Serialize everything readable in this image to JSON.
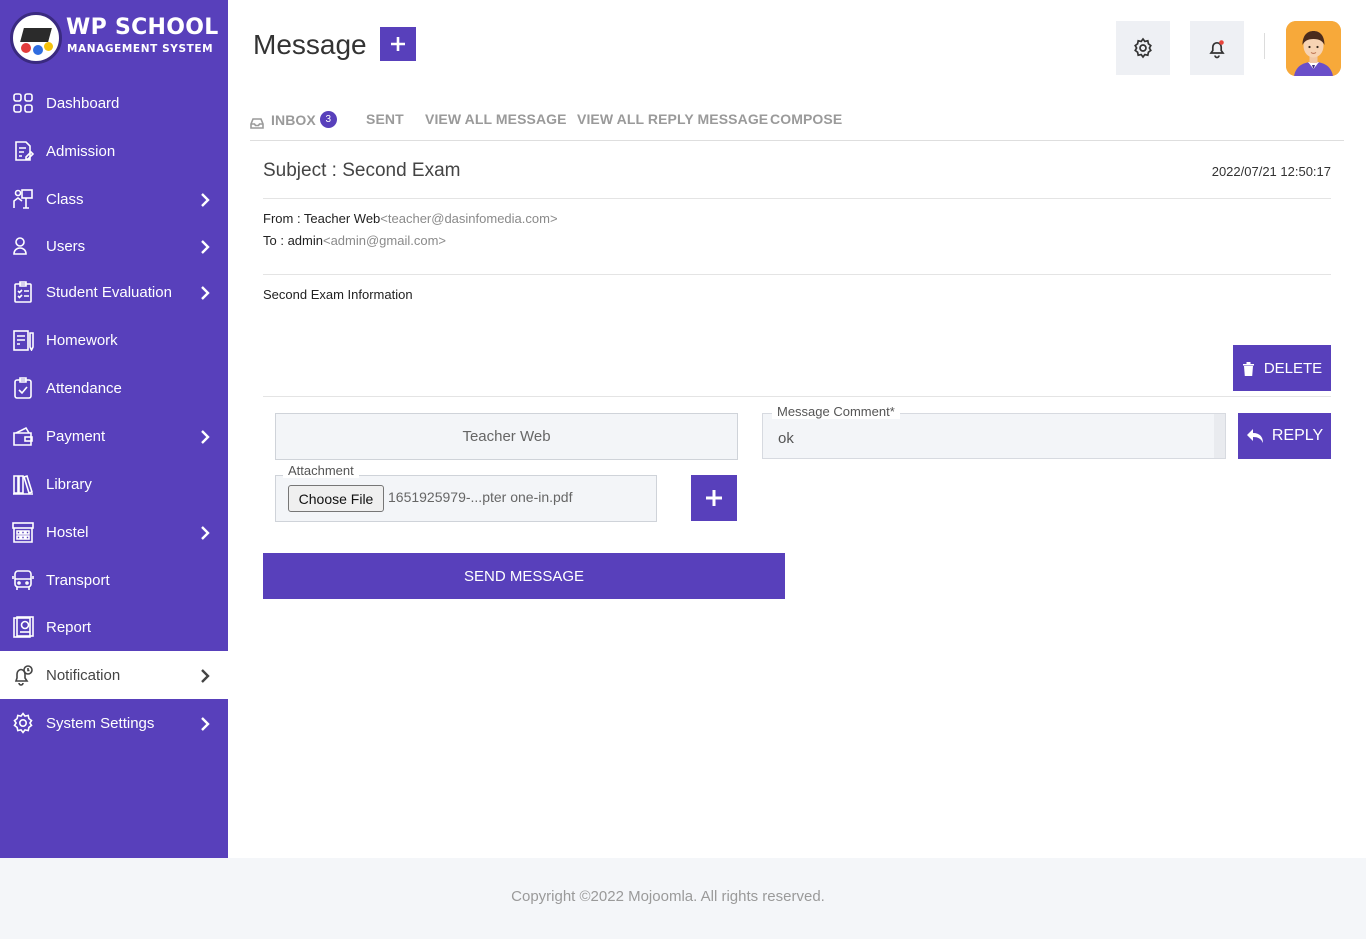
{
  "brand": {
    "title": "WP SCHOOL",
    "subtitle": "MANAGEMENT SYSTEM",
    "accent_color": "#5840bb"
  },
  "sidebar": {
    "items": [
      {
        "label": "Dashboard",
        "icon": "dashboard-icon",
        "has_submenu": false
      },
      {
        "label": "Admission",
        "icon": "admission-icon",
        "has_submenu": false
      },
      {
        "label": "Class",
        "icon": "class-icon",
        "has_submenu": true
      },
      {
        "label": "Users",
        "icon": "users-icon",
        "has_submenu": true
      },
      {
        "label": "Student Evaluation",
        "icon": "evaluation-icon",
        "has_submenu": true
      },
      {
        "label": "Homework",
        "icon": "homework-icon",
        "has_submenu": false
      },
      {
        "label": "Attendance",
        "icon": "attendance-icon",
        "has_submenu": false
      },
      {
        "label": "Payment",
        "icon": "payment-icon",
        "has_submenu": true
      },
      {
        "label": "Library",
        "icon": "library-icon",
        "has_submenu": false
      },
      {
        "label": "Hostel",
        "icon": "hostel-icon",
        "has_submenu": true
      },
      {
        "label": "Transport",
        "icon": "transport-icon",
        "has_submenu": false
      },
      {
        "label": "Report",
        "icon": "report-icon",
        "has_submenu": false
      },
      {
        "label": "Notification",
        "icon": "notification-icon",
        "has_submenu": true,
        "active": true
      },
      {
        "label": "System Settings",
        "icon": "settings-icon",
        "has_submenu": true
      }
    ]
  },
  "header": {
    "title": "Message",
    "add_button_icon": "plus-icon",
    "settings_icon": "gear-icon",
    "notifications_icon": "bell-icon",
    "avatar_icon": "user-avatar"
  },
  "tabs": {
    "inbox_label": "INBOX",
    "inbox_count": "3",
    "sent_label": "SENT",
    "view_all_label": "VIEW ALL MESSAGE",
    "view_all_reply_label": "VIEW ALL REPLY MESSAGE",
    "compose_label": "COMPOSE"
  },
  "message": {
    "subject": "Subject : Second Exam",
    "date": "2022/07/21 12:50:17",
    "from_label": "From : Teacher Web",
    "from_address": "<teacher@dasinfomedia.com>",
    "to_label": "To : admin",
    "to_address": "<admin@gmail.com>",
    "body": "Second Exam Information",
    "delete_label": "DELETE"
  },
  "reply_form": {
    "sender_name": "Teacher Web",
    "comment_label": "Message Comment*",
    "comment_value": "ok",
    "reply_label": "REPLY",
    "attachment_label": "Attachment",
    "choose_file_label": "Choose File",
    "file_name": "1651925979-...pter one-in.pdf",
    "send_label": "SEND MESSAGE"
  },
  "footer": {
    "copyright": "Copyright ©2022 Mojoomla. All rights reserved."
  }
}
